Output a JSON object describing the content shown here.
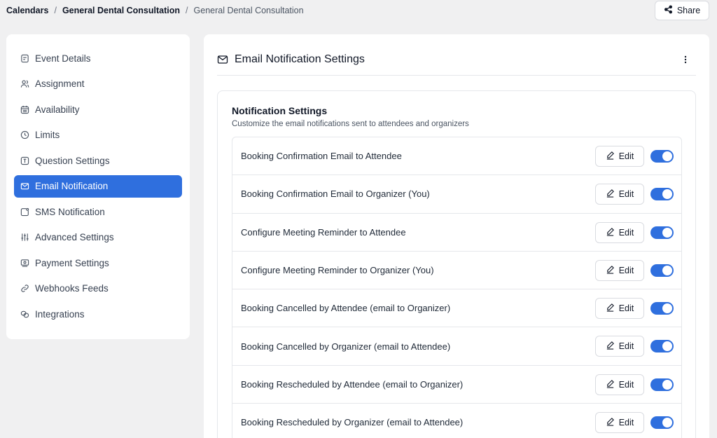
{
  "breadcrumb": {
    "root": "Calendars",
    "parent": "General Dental Consultation",
    "current": "General Dental Consultation",
    "separator": "/"
  },
  "header": {
    "share_label": "Share"
  },
  "sidebar": {
    "items": [
      {
        "label": "Event Details",
        "icon": "document-icon",
        "active": false
      },
      {
        "label": "Assignment",
        "icon": "users-icon",
        "active": false
      },
      {
        "label": "Availability",
        "icon": "calendar-icon",
        "active": false
      },
      {
        "label": "Limits",
        "icon": "clock-icon",
        "active": false
      },
      {
        "label": "Question Settings",
        "icon": "question-icon",
        "active": false
      },
      {
        "label": "Email Notification",
        "icon": "mail-icon",
        "active": true
      },
      {
        "label": "SMS Notification",
        "icon": "message-icon",
        "active": false
      },
      {
        "label": "Advanced Settings",
        "icon": "sliders-icon",
        "active": false
      },
      {
        "label": "Payment Settings",
        "icon": "payment-icon",
        "active": false
      },
      {
        "label": "Webhooks Feeds",
        "icon": "link-icon",
        "active": false
      },
      {
        "label": "Integrations",
        "icon": "integrations-icon",
        "active": false
      }
    ]
  },
  "main": {
    "title": "Email Notification Settings",
    "card": {
      "title": "Notification Settings",
      "subtitle": "Customize the email notifications sent to attendees and organizers",
      "edit_label": "Edit",
      "rows": [
        {
          "label": "Booking Confirmation Email to Attendee",
          "enabled": true
        },
        {
          "label": "Booking Confirmation Email to Organizer (You)",
          "enabled": true
        },
        {
          "label": "Configure Meeting Reminder to Attendee",
          "enabled": true
        },
        {
          "label": "Configure Meeting Reminder to Organizer (You)",
          "enabled": true
        },
        {
          "label": "Booking Cancelled by Attendee (email to Organizer)",
          "enabled": true
        },
        {
          "label": "Booking Cancelled by Organizer (email to Attendee)",
          "enabled": true
        },
        {
          "label": "Booking Rescheduled by Attendee (email to Organizer)",
          "enabled": true
        },
        {
          "label": "Booking Rescheduled by Organizer (email to Attendee)",
          "enabled": true
        }
      ]
    }
  },
  "colors": {
    "accent": "#2f6fde",
    "background": "#f0f0f1",
    "panel": "#ffffff"
  }
}
